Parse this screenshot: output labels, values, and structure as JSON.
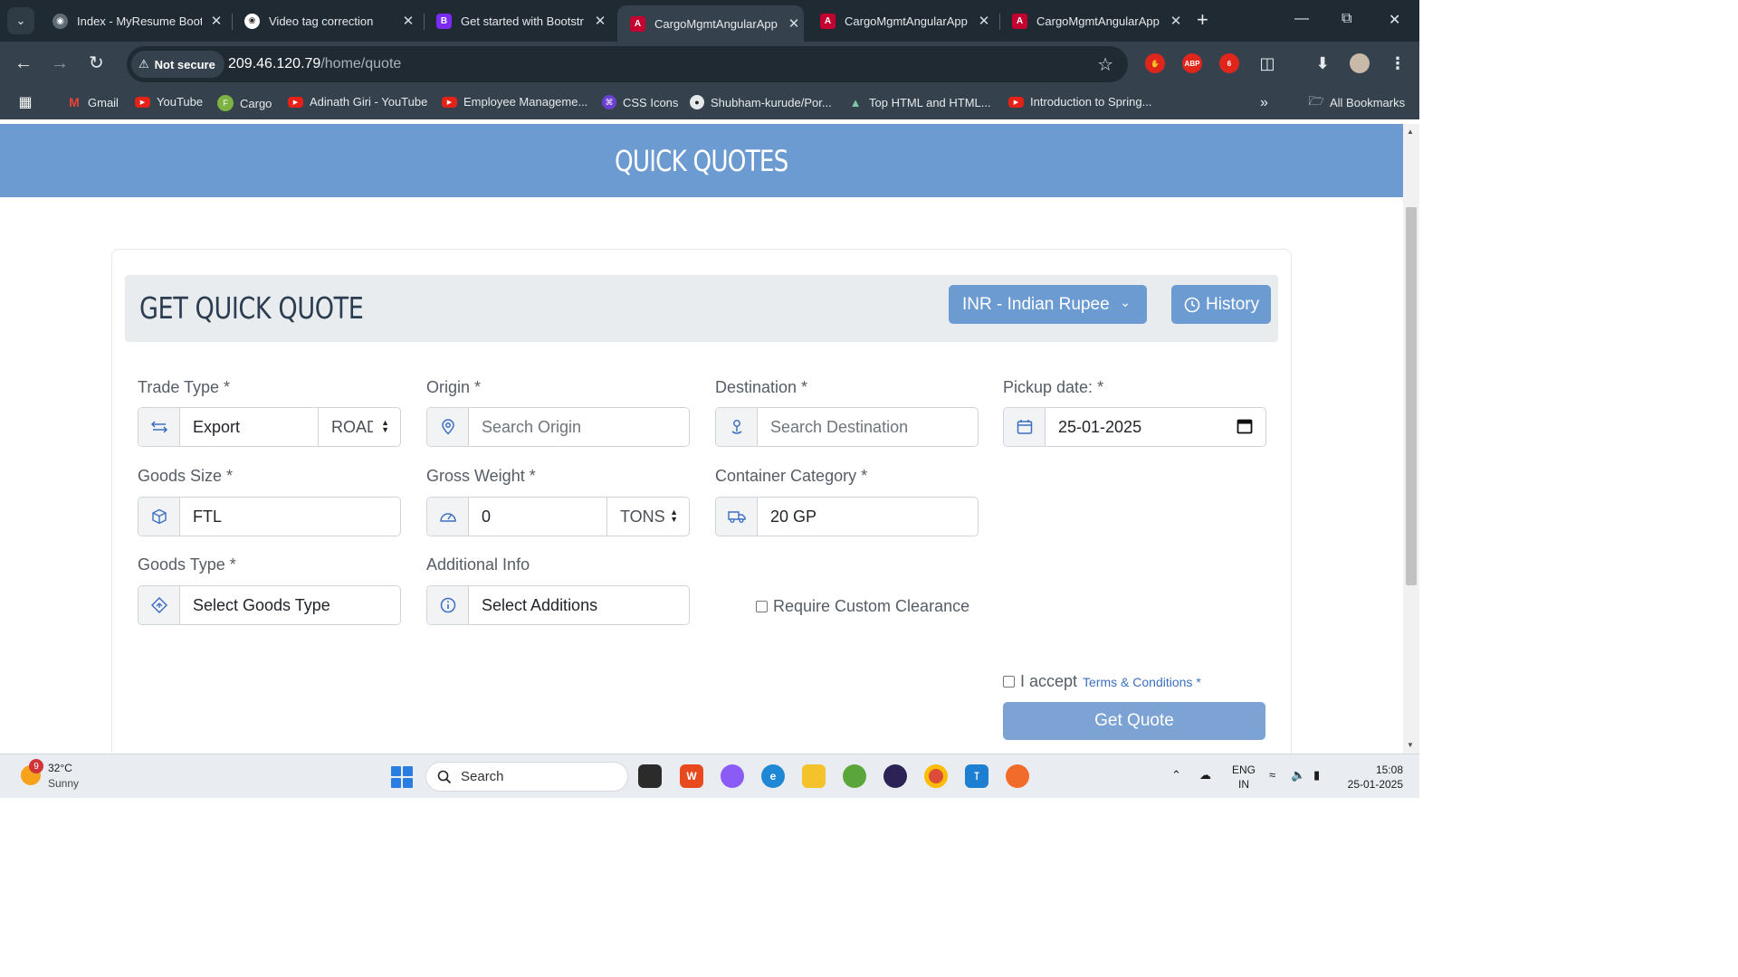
{
  "browser": {
    "tabs": [
      {
        "title": "Index - MyResume Boot",
        "icon": "globe-icon",
        "active": false
      },
      {
        "title": "Video tag correction",
        "icon": "chatgpt-icon",
        "active": false
      },
      {
        "title": "Get started with Bootstr",
        "icon": "bootstrap-icon",
        "active": false
      },
      {
        "title": "CargoMgmtAngularApp",
        "icon": "angular-icon",
        "active": true
      },
      {
        "title": "CargoMgmtAngularApp",
        "icon": "angular-icon",
        "active": false
      },
      {
        "title": "CargoMgmtAngularApp",
        "icon": "angular-icon",
        "active": false
      }
    ],
    "security_label": "Not secure",
    "url_host": "209.46.120.79",
    "url_path": "/home/quote",
    "bookmarks": [
      {
        "label": "Gmail",
        "icon": "gmail-icon"
      },
      {
        "label": "YouTube",
        "icon": "youtube-icon"
      },
      {
        "label": "Cargo",
        "icon": "cargo-icon"
      },
      {
        "label": "Adinath Giri - YouTube",
        "icon": "youtube-icon"
      },
      {
        "label": "Employee Manageme...",
        "icon": "youtube-icon"
      },
      {
        "label": "CSS Icons",
        "icon": "css-icons-icon"
      },
      {
        "label": "Shubham-kurude/Por...",
        "icon": "github-icon"
      },
      {
        "label": "Top HTML and HTML...",
        "icon": "mountain-icon"
      },
      {
        "label": "Introduction to Spring...",
        "icon": "youtube-icon"
      }
    ],
    "all_bookmarks": "All Bookmarks",
    "extension_badge": "6"
  },
  "page": {
    "banner_title": "QUICK QUOTES",
    "card_title": "GET QUICK QUOTE",
    "currency": "INR - Indian Rupee",
    "history_label": "History",
    "fields": {
      "trade_type": {
        "label": "Trade Type *",
        "value": "Export",
        "mode": "ROAD",
        "icon": "exchange-arrows-icon"
      },
      "origin": {
        "label": "Origin *",
        "placeholder": "Search Origin",
        "icon": "map-pin-icon"
      },
      "destination": {
        "label": "Destination *",
        "placeholder": "Search Destination",
        "icon": "location-person-icon"
      },
      "pickup_date": {
        "label": "Pickup date: *",
        "value": "25-01-2025",
        "icon": "calendar-icon"
      },
      "goods_size": {
        "label": "Goods Size *",
        "value": "FTL",
        "icon": "box-icon"
      },
      "gross_weight": {
        "label": "Gross Weight *",
        "value": "0",
        "unit": "TONS",
        "icon": "speedometer-icon"
      },
      "container_category": {
        "label": "Container Category *",
        "value": "20 GP",
        "icon": "truck-icon"
      },
      "goods_type": {
        "label": "Goods Type *",
        "value": "Select Goods Type",
        "icon": "diamond-icon"
      },
      "additional_info": {
        "label": "Additional Info",
        "value": "Select Additions",
        "icon": "info-icon"
      }
    },
    "custom_clearance_label": "Require Custom Clearance",
    "accept_label": "I accept",
    "terms_label": "Terms & Conditions *",
    "submit_label": "Get Quote"
  },
  "taskbar": {
    "weather_temp": "32°C",
    "weather_desc": "Sunny",
    "weather_badge": "9",
    "search_placeholder": "Search",
    "lang_top": "ENG",
    "lang_bottom": "IN",
    "time": "15:08",
    "date": "25-01-2025"
  }
}
